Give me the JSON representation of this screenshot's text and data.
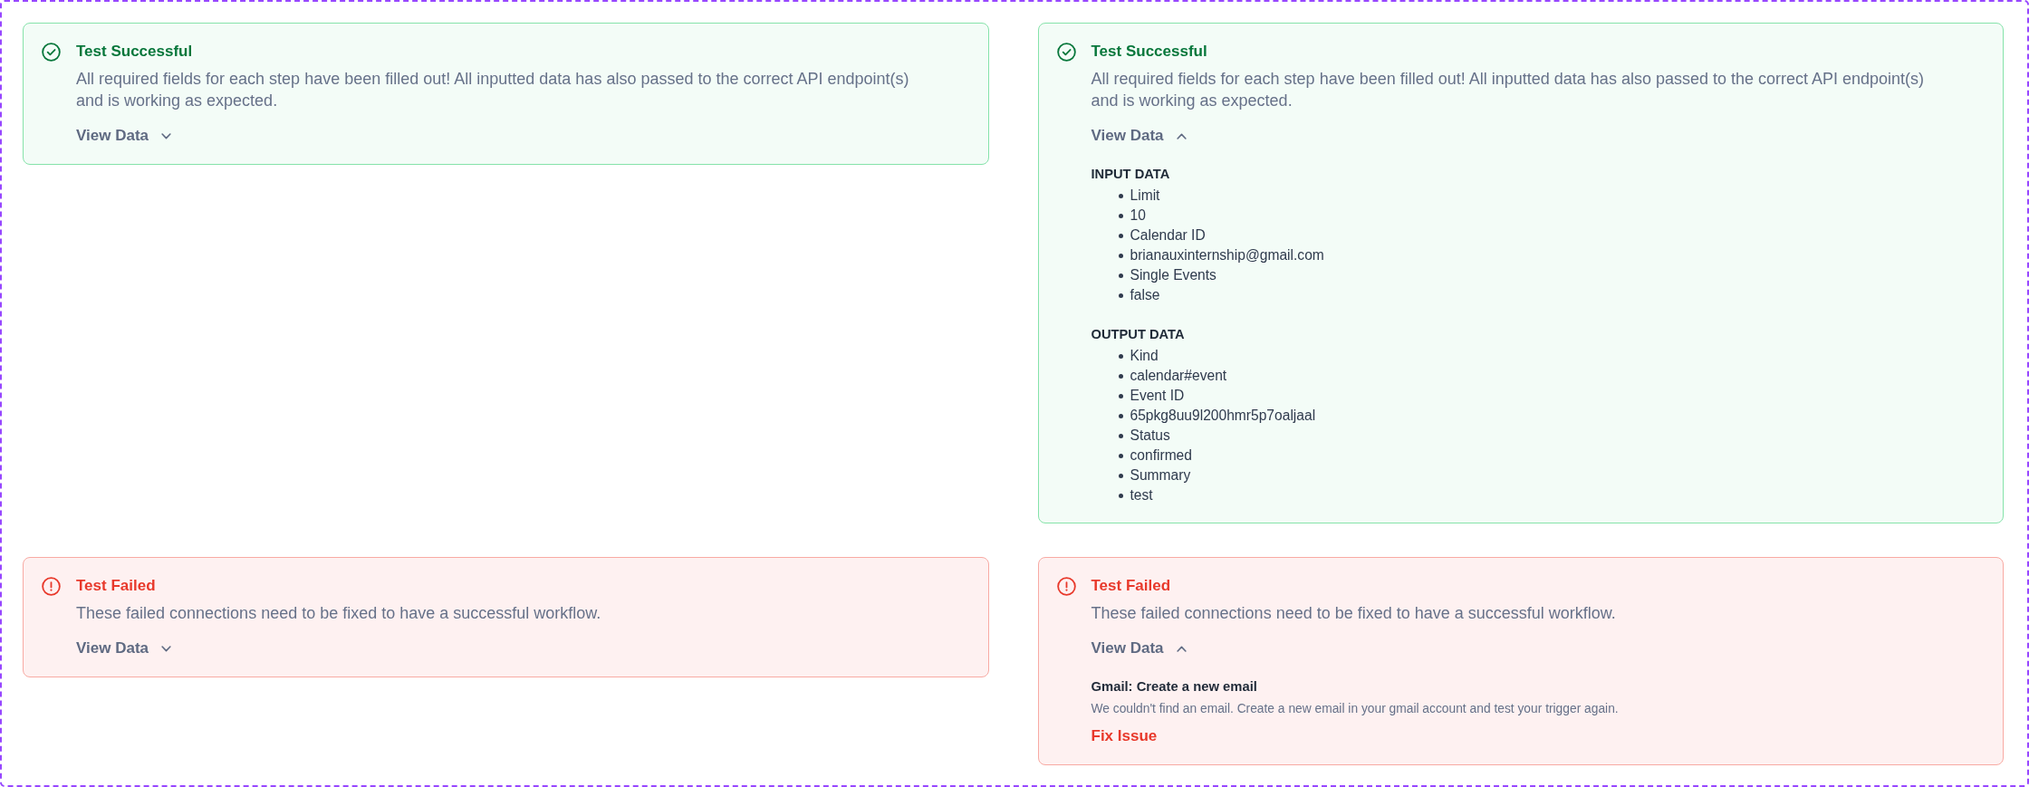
{
  "cards": [
    {
      "kind": "success",
      "title": "Test Successful",
      "description": "All required fields for each step have been filled out! All inputted data has also passed to the correct API endpoint(s) and is working as expected.",
      "toggle": {
        "label": "View Data",
        "expanded": false
      }
    },
    {
      "kind": "success",
      "title": "Test Successful",
      "description": "All required fields for each step have been filled out! All inputted data has also passed to the correct API endpoint(s) and is working as expected.",
      "toggle": {
        "label": "View Data",
        "expanded": true
      },
      "details": [
        {
          "kind": "list",
          "heading": "INPUT DATA",
          "items": [
            "Limit",
            "10",
            "Calendar ID",
            "brianauxinternship@gmail.com",
            "Single Events",
            "false"
          ]
        },
        {
          "kind": "list",
          "heading": "OUTPUT DATA",
          "items": [
            "Kind",
            "calendar#event",
            "Event ID",
            "65pkg8uu9l200hmr5p7oaljaal",
            "Status",
            "confirmed",
            "Summary",
            "test"
          ]
        }
      ]
    },
    {
      "kind": "failed",
      "title": "Test Failed",
      "description": "These failed connections need to be fixed to have a successful workflow.",
      "toggle": {
        "label": "View Data",
        "expanded": false
      }
    },
    {
      "kind": "failed",
      "title": "Test Failed",
      "description": "These failed connections need to be fixed to have a successful workflow.",
      "toggle": {
        "label": "View Data",
        "expanded": true
      },
      "details": [
        {
          "kind": "issue",
          "title": "Gmail: Create a new email",
          "message": "We couldn't find an email. Create a new email in your gmail account and test your trigger again.",
          "action": "Fix Issue"
        }
      ]
    }
  ]
}
